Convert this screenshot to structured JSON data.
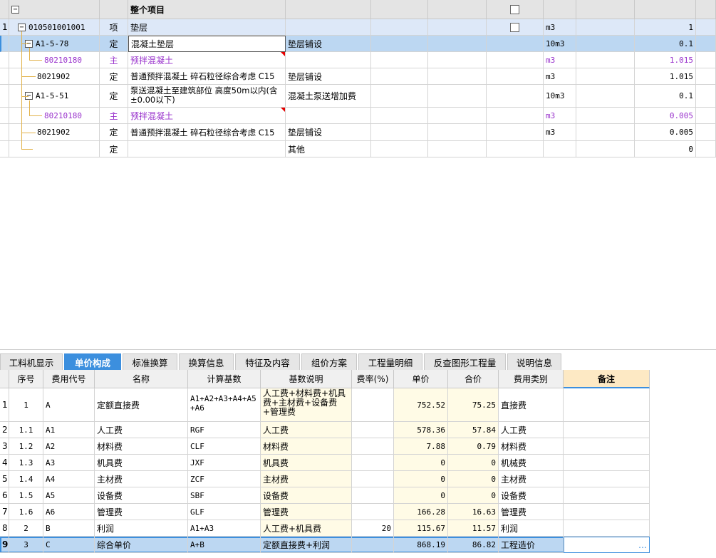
{
  "top_table": {
    "header": {
      "code": "",
      "name": "整个项目"
    },
    "rows": [
      {
        "row_no": "1",
        "code": "010501001001",
        "type": "项",
        "name": "垫层",
        "feature": "",
        "unit": "m3",
        "qty": "1"
      },
      {
        "row_no": "",
        "code": "A1-5-78",
        "type": "定",
        "name": "混凝土垫层",
        "feature": "垫层铺设",
        "unit": "10m3",
        "qty": "0.1"
      },
      {
        "row_no": "",
        "code": "80210180",
        "type": "主",
        "name": "预拌混凝土",
        "feature": "",
        "unit": "m3",
        "qty": "1.015"
      },
      {
        "row_no": "",
        "code": "8021902",
        "type": "定",
        "name": "普通预拌混凝土 碎石粒径综合考虑 C15",
        "feature": "垫层铺设",
        "unit": "m3",
        "qty": "1.015"
      },
      {
        "row_no": "",
        "code": "A1-5-51",
        "type": "定",
        "name": "泵送混凝土至建筑部位 高度50m以内(含±0.00以下)",
        "feature": "混凝土泵送增加费",
        "unit": "10m3",
        "qty": "0.1"
      },
      {
        "row_no": "",
        "code": "80210180",
        "type": "主",
        "name": "预拌混凝土",
        "feature": "",
        "unit": "m3",
        "qty": "0.005"
      },
      {
        "row_no": "",
        "code": "8021902",
        "type": "定",
        "name": "普通预拌混凝土 碎石粒径综合考虑 C15",
        "feature": "垫层铺设",
        "unit": "m3",
        "qty": "0.005"
      },
      {
        "row_no": "",
        "code": "",
        "type": "定",
        "name": "",
        "feature": "其他",
        "unit": "",
        "qty": "0"
      }
    ]
  },
  "tabs": [
    {
      "label": "工料机显示"
    },
    {
      "label": "单价构成"
    },
    {
      "label": "标准换算"
    },
    {
      "label": "换算信息"
    },
    {
      "label": "特征及内容"
    },
    {
      "label": "组价方案"
    },
    {
      "label": "工程量明细"
    },
    {
      "label": "反查图形工程量"
    },
    {
      "label": "说明信息"
    }
  ],
  "bottom_table": {
    "columns": {
      "seq": "序号",
      "code": "费用代号",
      "name": "名称",
      "base": "计算基数",
      "base_desc": "基数说明",
      "rate": "费率(%)",
      "unit_price": "单价",
      "total": "合价",
      "category": "费用类别",
      "remark": "备注"
    },
    "rows": [
      {
        "row_no": "1",
        "seq": "1",
        "code": "A",
        "name": "定额直接费",
        "base": "A1+A2+A3+A4+A5+A6",
        "base_desc": "人工费+材料费+机具费+主材费+设备费+管理费",
        "rate": "",
        "unit_price": "752.52",
        "total": "75.25",
        "category": "直接费",
        "remark": ""
      },
      {
        "row_no": "2",
        "seq": "1.1",
        "code": "A1",
        "name": "人工费",
        "base": "RGF",
        "base_desc": "人工费",
        "rate": "",
        "unit_price": "578.36",
        "total": "57.84",
        "category": "人工费",
        "remark": ""
      },
      {
        "row_no": "3",
        "seq": "1.2",
        "code": "A2",
        "name": "材料费",
        "base": "CLF",
        "base_desc": "材料费",
        "rate": "",
        "unit_price": "7.88",
        "total": "0.79",
        "category": "材料费",
        "remark": ""
      },
      {
        "row_no": "4",
        "seq": "1.3",
        "code": "A3",
        "name": "机具费",
        "base": "JXF",
        "base_desc": "机具费",
        "rate": "",
        "unit_price": "0",
        "total": "0",
        "category": "机械费",
        "remark": ""
      },
      {
        "row_no": "5",
        "seq": "1.4",
        "code": "A4",
        "name": "主材费",
        "base": "ZCF",
        "base_desc": "主材费",
        "rate": "",
        "unit_price": "0",
        "total": "0",
        "category": "主材费",
        "remark": ""
      },
      {
        "row_no": "6",
        "seq": "1.5",
        "code": "A5",
        "name": "设备费",
        "base": "SBF",
        "base_desc": "设备费",
        "rate": "",
        "unit_price": "0",
        "total": "0",
        "category": "设备费",
        "remark": ""
      },
      {
        "row_no": "7",
        "seq": "1.6",
        "code": "A6",
        "name": "管理费",
        "base": "GLF",
        "base_desc": "管理费",
        "rate": "",
        "unit_price": "166.28",
        "total": "16.63",
        "category": "管理费",
        "remark": ""
      },
      {
        "row_no": "8",
        "seq": "2",
        "code": "B",
        "name": "利润",
        "base": "A1+A3",
        "base_desc": "人工费+机具费",
        "rate": "20",
        "unit_price": "115.67",
        "total": "11.57",
        "category": "利润",
        "remark": ""
      },
      {
        "row_no": "9",
        "seq": "3",
        "code": "C",
        "name": "综合单价",
        "base": "A+B",
        "base_desc": "定额直接费+利润",
        "rate": "",
        "unit_price": "868.19",
        "total": "86.82",
        "category": "工程造价",
        "remark": "…"
      }
    ]
  },
  "colors": {
    "selected_row": "#bcd7f2",
    "header_bg": "#f0f0f0",
    "accent_tab": "#3c8fde",
    "purple_text": "#9932cc",
    "cream": "#fffbe6",
    "remark_header": "#fde9c4"
  }
}
